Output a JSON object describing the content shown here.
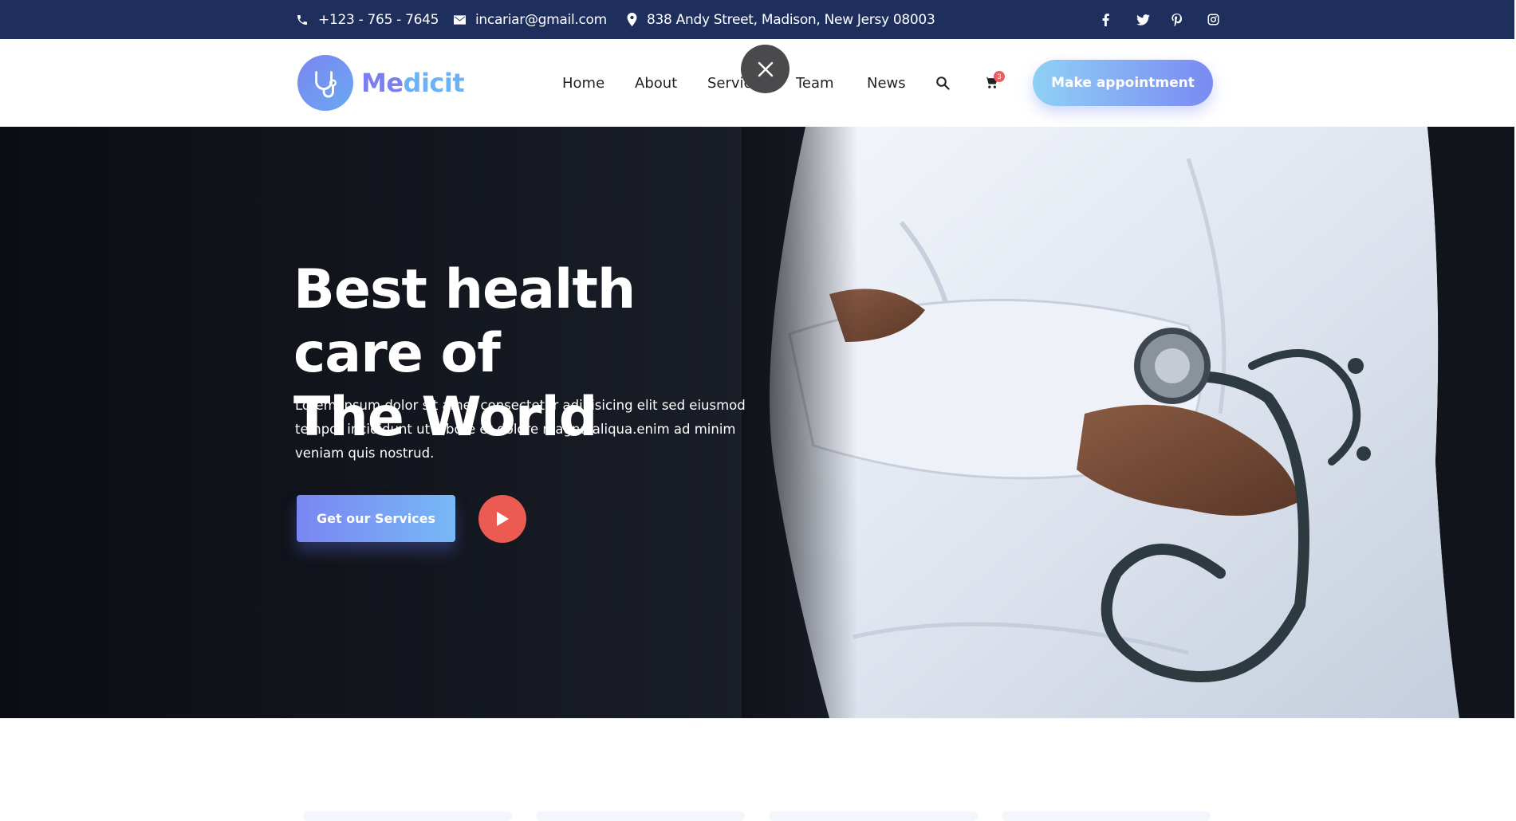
{
  "topbar": {
    "phone": "+123 - 765 - 7645",
    "email": "incariar@gmail.com",
    "address": "838 Andy Street, Madison, New Jersy 08003",
    "social": [
      "facebook-icon",
      "twitter-icon",
      "pinterest-icon",
      "instagram-icon"
    ]
  },
  "header": {
    "logo_me": "Me",
    "logo_dicit": "dicit",
    "nav": [
      "Home",
      "About",
      "Services",
      "Team",
      "News"
    ],
    "cart_count": "3",
    "appointment_label": "Make appointment"
  },
  "hero": {
    "title_line1": "Best health care of",
    "title_line2": "The World",
    "text": "Lorem ipsum dolor sit amet consectetur adipisicing elit sed eiusmod tempor incididunt ut labore et dolore magna aliqua.enim ad minim veniam quis nostrud.",
    "cta_label": "Get our Services"
  },
  "colors": {
    "topbar": "#1e2f5e",
    "accent_blue": "#7a86f2",
    "accent_light": "#8fd0f6",
    "play_red": "#ec5b52"
  }
}
